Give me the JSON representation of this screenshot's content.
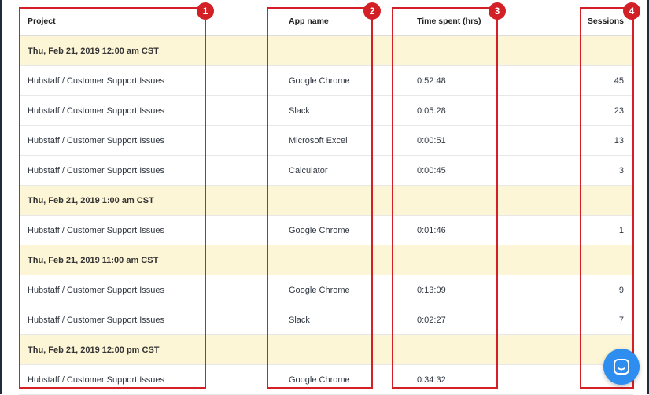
{
  "table": {
    "headers": {
      "project": "Project",
      "app": "App name",
      "time": "Time spent (hrs)",
      "sessions": "Sessions"
    },
    "rows": [
      {
        "type": "group",
        "project": "Thu, Feb 21, 2019 12:00 am CST"
      },
      {
        "type": "item",
        "project": "Hubstaff / Customer Support Issues",
        "app": "Google Chrome",
        "time": "0:52:48",
        "sessions": "45"
      },
      {
        "type": "item",
        "project": "Hubstaff / Customer Support Issues",
        "app": "Slack",
        "time": "0:05:28",
        "sessions": "23"
      },
      {
        "type": "item",
        "project": "Hubstaff / Customer Support Issues",
        "app": "Microsoft Excel",
        "time": "0:00:51",
        "sessions": "13"
      },
      {
        "type": "item",
        "project": "Hubstaff / Customer Support Issues",
        "app": "Calculator",
        "time": "0:00:45",
        "sessions": "3"
      },
      {
        "type": "group",
        "project": "Thu, Feb 21, 2019 1:00 am CST"
      },
      {
        "type": "item",
        "project": "Hubstaff / Customer Support Issues",
        "app": "Google Chrome",
        "time": "0:01:46",
        "sessions": "1"
      },
      {
        "type": "group",
        "project": "Thu, Feb 21, 2019 11:00 am CST"
      },
      {
        "type": "item",
        "project": "Hubstaff / Customer Support Issues",
        "app": "Google Chrome",
        "time": "0:13:09",
        "sessions": "9"
      },
      {
        "type": "item",
        "project": "Hubstaff / Customer Support Issues",
        "app": "Slack",
        "time": "0:02:27",
        "sessions": "7"
      },
      {
        "type": "group",
        "project": "Thu, Feb 21, 2019 12:00 pm CST"
      },
      {
        "type": "item",
        "project": "Hubstaff / Customer Support Issues",
        "app": "Google Chrome",
        "time": "0:34:32",
        "sessions": ""
      }
    ]
  },
  "annotations": {
    "badges": [
      "1",
      "2",
      "3",
      "4"
    ],
    "color": "#d32027"
  },
  "colors": {
    "group_row_bg": "#fdf6d6",
    "chat_button": "#2d8ef0"
  },
  "chat": {
    "icon": "chat-bubble-icon"
  }
}
